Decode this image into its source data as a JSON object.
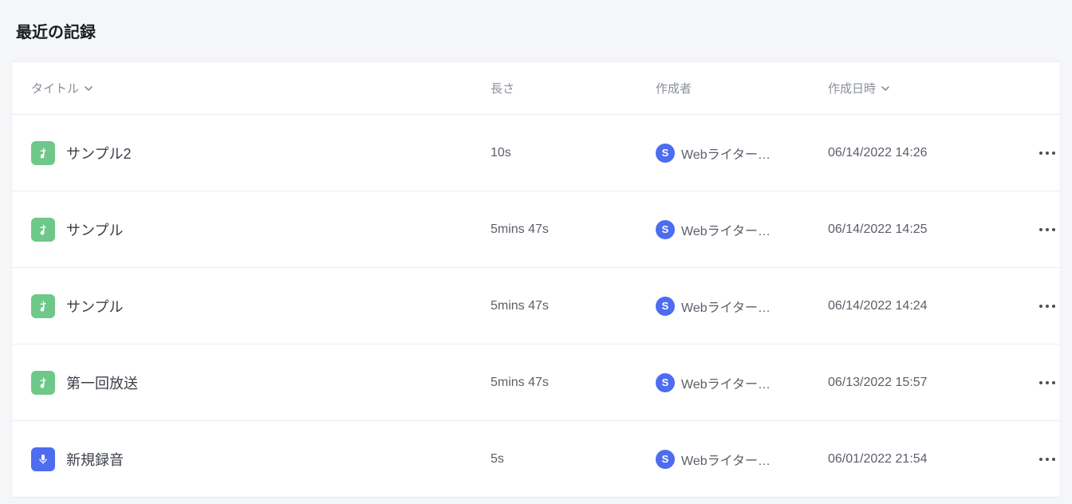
{
  "heading": "最近の記録",
  "columns": {
    "title": "タイトル",
    "length": "長さ",
    "author": "作成者",
    "created": "作成日時"
  },
  "avatar_initial": "S",
  "rows": [
    {
      "icon": "audio-file",
      "title": "サンプル2",
      "length": "10s",
      "author": "Webライター…",
      "created": "06/14/2022 14:26"
    },
    {
      "icon": "audio-file",
      "title": "サンプル",
      "length": "5mins 47s",
      "author": "Webライター…",
      "created": "06/14/2022 14:25"
    },
    {
      "icon": "audio-file",
      "title": "サンプル",
      "length": "5mins 47s",
      "author": "Webライター…",
      "created": "06/14/2022 14:24"
    },
    {
      "icon": "audio-file",
      "title": "第一回放送",
      "length": "5mins 47s",
      "author": "Webライター…",
      "created": "06/13/2022 15:57"
    },
    {
      "icon": "voice-rec",
      "title": "新規録音",
      "length": "5s",
      "author": "Webライター…",
      "created": "06/01/2022 21:54"
    }
  ]
}
